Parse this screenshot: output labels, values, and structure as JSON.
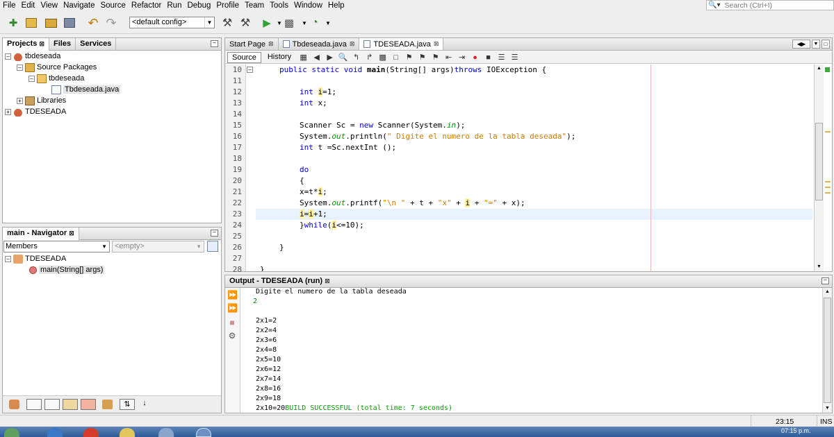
{
  "menubar": {
    "items": [
      "File",
      "Edit",
      "View",
      "Navigate",
      "Source",
      "Refactor",
      "Run",
      "Debug",
      "Profile",
      "Team",
      "Tools",
      "Window",
      "Help"
    ],
    "search_placeholder": "Search (Ctrl+I)"
  },
  "toolbar": {
    "config": "<default config>"
  },
  "projects_panel": {
    "tabs": [
      "Projects",
      "Files",
      "Services"
    ],
    "tree": [
      {
        "label": "tbdeseada"
      },
      {
        "label": "Source Packages"
      },
      {
        "label": "tbdeseada"
      },
      {
        "label": "Tbdeseada.java"
      },
      {
        "label": "Libraries"
      },
      {
        "label": "TDESEADA"
      }
    ]
  },
  "navigator": {
    "title": "main - Navigator",
    "members_label": "Members",
    "filter_placeholder": "<empty>",
    "tree": [
      {
        "label": "TDESEADA"
      },
      {
        "label": "main(String[] args)"
      }
    ]
  },
  "editor": {
    "tabs": [
      {
        "label": "Start Page"
      },
      {
        "label": "Tbdeseada.java"
      },
      {
        "label": "TDESEADA.java"
      }
    ],
    "source_label": "Source",
    "history_label": "History",
    "line_numbers": [
      "10",
      "11",
      "12",
      "13",
      "14",
      "15",
      "16",
      "17",
      "18",
      "19",
      "20",
      "21",
      "22",
      "23",
      "24",
      "25",
      "26",
      "27",
      "28"
    ],
    "code": {
      "l10_a": "public static void ",
      "l10_b": "main",
      "l10_c": "(String[] args)",
      "l10_d": "throws",
      "l10_e": " IOException {",
      "l12_a": "int ",
      "l12_b": "i",
      "l12_c": "=1;",
      "l13_a": "int ",
      "l13_b": "x;",
      "l15_a": "Scanner Sc = ",
      "l15_b": "new",
      "l15_c": " Scanner(System.",
      "l15_d": "in",
      "l15_e": ");",
      "l16_a": "System.",
      "l16_b": "out",
      "l16_c": ".println(",
      "l16_d": "\" Digite el numero de la tabla deseada\"",
      "l16_e": ");",
      "l17_a": "int ",
      "l17_b": "t =Sc.nextInt ();",
      "l19": "do",
      "l20": "{",
      "l21_a": "x=t*",
      "l21_b": "i",
      "l21_c": ";",
      "l22_a": "System.",
      "l22_b": "out",
      "l22_c": ".printf(",
      "l22_d": "\"\\n \"",
      "l22_e": " + t + ",
      "l22_f": "\"x\"",
      "l22_g": " + ",
      "l22_h": "i",
      "l22_i": " + ",
      "l22_j": "\"=\"",
      "l22_k": " + x);",
      "l23_a": "i",
      "l23_b": "=",
      "l23_c": "i",
      "l23_d": "+1;",
      "l24_a": "}",
      "l24_b": "while",
      "l24_c": "(",
      "l24_d": "i",
      "l24_e": "<=10);",
      "l26": "}",
      "l28": "}"
    }
  },
  "output": {
    "title": "Output - TDESEADA (run)",
    "lines": [
      "Digite el numero de la tabla deseada",
      "2",
      "",
      "2x1=2",
      "2x2=4",
      "2x3=6",
      "2x4=8",
      "2x5=10",
      "2x6=12",
      "2x7=14",
      "2x8=16",
      "2x9=18"
    ],
    "last_line_prefix": "2x10=20",
    "last_line_success": "BUILD SUCCESSFUL (total time: 7 seconds)"
  },
  "statusbar": {
    "position": "23:15",
    "mode": "INS"
  },
  "taskbar": {
    "clock": "07:15 p.m."
  }
}
